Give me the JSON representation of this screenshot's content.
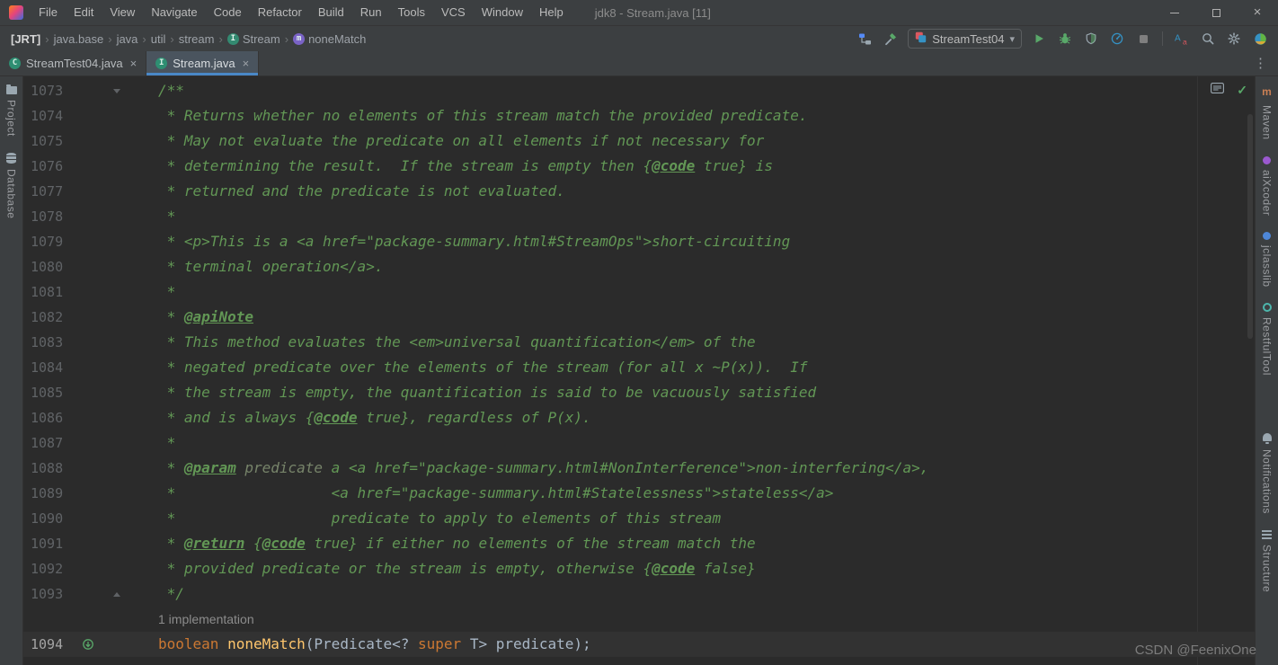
{
  "window": {
    "title": "jdk8 - Stream.java [11]"
  },
  "menu": [
    "File",
    "Edit",
    "View",
    "Navigate",
    "Code",
    "Refactor",
    "Build",
    "Run",
    "Tools",
    "VCS",
    "Window",
    "Help"
  ],
  "breadcrumbs": {
    "root": "[JRT]",
    "items": [
      {
        "label": "java.base"
      },
      {
        "label": "java"
      },
      {
        "label": "util"
      },
      {
        "label": "stream"
      },
      {
        "label": "Stream",
        "icon": "interface"
      },
      {
        "label": "noneMatch",
        "icon": "method"
      }
    ]
  },
  "toolbar": {
    "run_config": "StreamTest04"
  },
  "tabs": [
    {
      "label": "StreamTest04.java",
      "icon_letter": "C",
      "active": false
    },
    {
      "label": "Stream.java",
      "icon_letter": "I",
      "active": true
    }
  ],
  "left_stripe": [
    {
      "label": "Project",
      "icon": "folder"
    },
    {
      "label": "Database",
      "icon": "database"
    }
  ],
  "right_stripe": [
    {
      "label": "Maven",
      "icon": "m"
    },
    {
      "label": "aiXcoder",
      "icon": "dot-purple"
    },
    {
      "label": "jclasslib",
      "icon": "dot-blue"
    },
    {
      "label": "RestfulTool",
      "icon": "circle-teal"
    },
    {
      "label": "Notifications",
      "icon": "bell"
    },
    {
      "label": "Structure",
      "icon": "structure"
    }
  ],
  "editor": {
    "hint": "1 implementation",
    "lines": [
      {
        "n": "1073",
        "fold": "start",
        "seg": [
          [
            "/**",
            "doc"
          ]
        ]
      },
      {
        "n": "1074",
        "seg": [
          [
            " * Returns whether no elements of this stream match the provided predicate.",
            "doc"
          ]
        ]
      },
      {
        "n": "1075",
        "seg": [
          [
            " * May not evaluate the predicate on all elements if not necessary for",
            "doc"
          ]
        ]
      },
      {
        "n": "1076",
        "seg": [
          [
            " * determining the result.  If the stream is empty then {",
            "doc"
          ],
          [
            "@code",
            "doctag"
          ],
          [
            " true} is",
            "doc"
          ]
        ]
      },
      {
        "n": "1077",
        "seg": [
          [
            " * returned and the predicate is not evaluated.",
            "doc"
          ]
        ]
      },
      {
        "n": "1078",
        "seg": [
          [
            " *",
            "doc"
          ]
        ]
      },
      {
        "n": "1079",
        "seg": [
          [
            " * <p>This is a <a href=\"package-summary.html#StreamOps\">short-circuiting",
            "doc"
          ]
        ]
      },
      {
        "n": "1080",
        "seg": [
          [
            " * terminal operation</a>.",
            "doc"
          ]
        ]
      },
      {
        "n": "1081",
        "seg": [
          [
            " *",
            "doc"
          ]
        ]
      },
      {
        "n": "1082",
        "seg": [
          [
            " * ",
            "doc"
          ],
          [
            "@apiNote",
            "doctag"
          ]
        ]
      },
      {
        "n": "1083",
        "seg": [
          [
            " * This method evaluates the <em>universal quantification</em> of the",
            "doc"
          ]
        ]
      },
      {
        "n": "1084",
        "seg": [
          [
            " * negated predicate over the elements of the stream (for all x ~P(x)).  If",
            "doc"
          ]
        ]
      },
      {
        "n": "1085",
        "seg": [
          [
            " * the stream is empty, the quantification is said to be vacuously satisfied",
            "doc"
          ]
        ]
      },
      {
        "n": "1086",
        "seg": [
          [
            " * and is always {",
            "doc"
          ],
          [
            "@code",
            "doctag"
          ],
          [
            " true}, regardless of P(x).",
            "doc"
          ]
        ]
      },
      {
        "n": "1087",
        "seg": [
          [
            " *",
            "doc"
          ]
        ]
      },
      {
        "n": "1088",
        "seg": [
          [
            " * ",
            "doc"
          ],
          [
            "@param",
            "doctag"
          ],
          [
            " ",
            "doc"
          ],
          [
            "predicate",
            "docval"
          ],
          [
            " a <a href=\"package-summary.html#NonInterference\">non-interfering</a>,",
            "doc"
          ]
        ]
      },
      {
        "n": "1089",
        "seg": [
          [
            " *                  <a href=\"package-summary.html#Statelessness\">stateless</a>",
            "doc"
          ]
        ]
      },
      {
        "n": "1090",
        "seg": [
          [
            " *                  predicate to apply to elements of this stream",
            "doc"
          ]
        ]
      },
      {
        "n": "1091",
        "seg": [
          [
            " * ",
            "doc"
          ],
          [
            "@return",
            "doctag"
          ],
          [
            " {",
            "doc"
          ],
          [
            "@code",
            "doctag"
          ],
          [
            " true} if either no elements of the stream match the",
            "doc"
          ]
        ]
      },
      {
        "n": "1092",
        "seg": [
          [
            " * provided predicate or the stream is empty, otherwise {",
            "doc"
          ],
          [
            "@code",
            "doctag"
          ],
          [
            " false}",
            "doc"
          ]
        ]
      },
      {
        "n": "1093",
        "fold": "end",
        "seg": [
          [
            " */",
            "doc"
          ]
        ]
      },
      {
        "hint": true
      },
      {
        "n": "1094",
        "current": true,
        "gutter_icon": "implements",
        "seg": [
          [
            "boolean",
            "kw"
          ],
          [
            " ",
            "pl"
          ],
          [
            "noneMatch",
            "method"
          ],
          [
            "(Predicate<? ",
            "pl"
          ],
          [
            "super",
            "kw"
          ],
          [
            " T> predicate);",
            "pl"
          ]
        ]
      }
    ]
  },
  "watermark": "CSDN @FeenixOne",
  "icons": {
    "chevron_sep": "›",
    "close": "×",
    "kebab": "⋮",
    "caret_down": "▾",
    "check": "✓"
  },
  "colors": {
    "background": "#2b2b2b",
    "chrome": "#3c3f41",
    "doc_comment": "#629755",
    "keyword": "#cc7832",
    "method": "#ffc66d",
    "plain": "#a9b7c6",
    "line_number": "#606366",
    "current_line": "#323232",
    "tab_underline": "#4a88c7",
    "run_green": "#59A869"
  }
}
